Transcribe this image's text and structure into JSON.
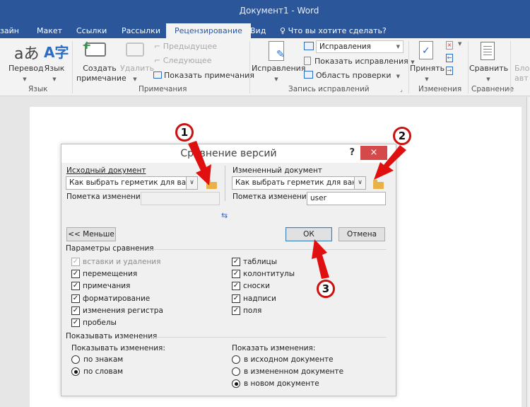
{
  "window": {
    "title": "Документ1 - Word"
  },
  "tabs": [
    {
      "label": "зайн"
    },
    {
      "label": "Макет"
    },
    {
      "label": "Ссылки"
    },
    {
      "label": "Рассылки"
    },
    {
      "label": "Рецензирование",
      "active": true
    },
    {
      "label": "Вид"
    }
  ],
  "tell_me": "Что вы хотите сделать?",
  "ribbon": {
    "groups": {
      "language": "Язык",
      "comments": "Примечания",
      "tracking": "Запись исправлений",
      "changes": "Изменения",
      "compare": "Сравнение"
    },
    "translate": "Перевод",
    "language": "Язык",
    "new_comment_1": "Создать",
    "new_comment_2": "примечание",
    "delete": "Удалить",
    "previous": "Предыдущее",
    "next": "Следующее",
    "show_comments": "Показать примечания",
    "track_changes": "Исправления",
    "markup_dropdown": "Исправления",
    "show_markup": "Показать исправления",
    "reviewing_pane": "Область проверки",
    "accept": "Принять",
    "compare": "Сравнить",
    "block_1": "Блок",
    "block_2": "авт"
  },
  "dialog": {
    "title": "Сравнение версий",
    "help": "?",
    "close": "×",
    "original_label": "Исходный документ",
    "original_value": "Как выбрать герметик для ванной.d",
    "original_markup_label": "Пометка изменений",
    "original_markup_value": "",
    "revised_label": "Измененный документ",
    "revised_value": "Как выбрать герметик для ванной.",
    "revised_markup_label": "Пометка изменений",
    "revised_markup_value": "user",
    "less_button": "<< Меньше",
    "ok_button": "ОК",
    "cancel_button": "Отмена",
    "settings_title": "Параметры сравнения",
    "settings_left": [
      {
        "label": "вставки и удаления",
        "checked": true,
        "disabled": true
      },
      {
        "label": "перемещения",
        "checked": true
      },
      {
        "label": "примечания",
        "checked": true
      },
      {
        "label": "форматирование",
        "checked": true
      },
      {
        "label": "изменения регистра",
        "checked": true
      },
      {
        "label": "пробелы",
        "checked": true
      }
    ],
    "settings_right": [
      {
        "label": "таблицы",
        "checked": true
      },
      {
        "label": "колонтитулы",
        "checked": true
      },
      {
        "label": "сноски",
        "checked": true
      },
      {
        "label": "надписи",
        "checked": true
      },
      {
        "label": "поля",
        "checked": true
      }
    ],
    "show_title": "Показывать изменения",
    "granularity_label": "Показывать изменения:",
    "granularity_options": [
      {
        "label": "по знакам",
        "selected": false
      },
      {
        "label": "по словам",
        "selected": true
      }
    ],
    "target_label": "Показать изменения:",
    "target_options": [
      {
        "label": "в исходном документе",
        "selected": false
      },
      {
        "label": "в измененном документе",
        "selected": false
      },
      {
        "label": "в новом документе",
        "selected": true
      }
    ]
  },
  "annotations": {
    "marker1": "1",
    "marker2": "2",
    "marker3": "3",
    "color": "#cc1111"
  }
}
